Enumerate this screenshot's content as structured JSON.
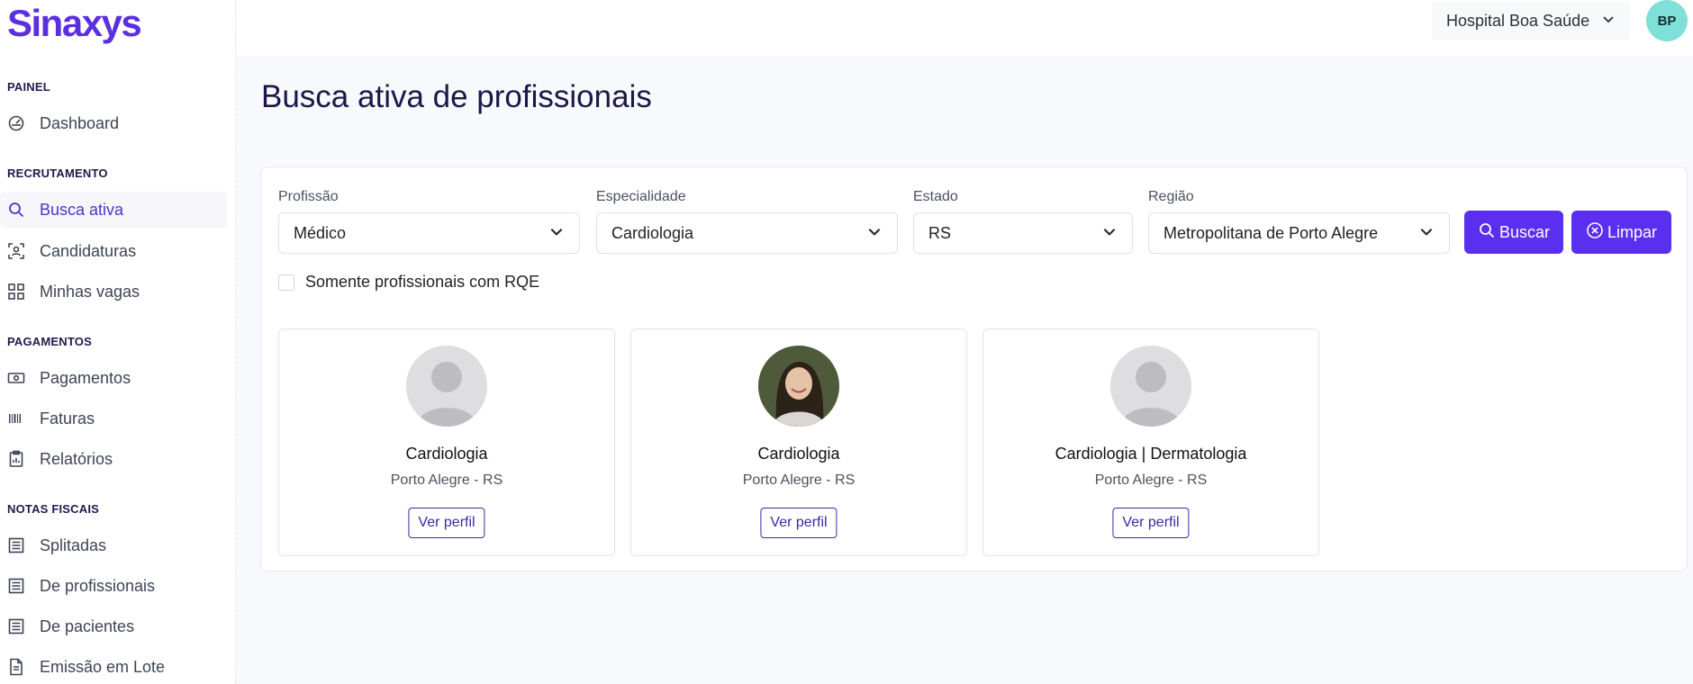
{
  "app": {
    "logo": "Sinaxys"
  },
  "sidebar": {
    "sections": [
      {
        "title": "PAINEL",
        "items": [
          {
            "label": "Dashboard",
            "icon": "dashboard-icon"
          }
        ]
      },
      {
        "title": "RECRUTAMENTO",
        "items": [
          {
            "label": "Busca ativa",
            "icon": "search-icon",
            "active": true
          },
          {
            "label": "Candidaturas",
            "icon": "user-scan-icon"
          },
          {
            "label": "Minhas vagas",
            "icon": "grid-icon"
          }
        ]
      },
      {
        "title": "PAGAMENTOS",
        "items": [
          {
            "label": "Pagamentos",
            "icon": "money-icon"
          },
          {
            "label": "Faturas",
            "icon": "barcode-icon"
          },
          {
            "label": "Relatórios",
            "icon": "clipboard-icon"
          }
        ]
      },
      {
        "title": "NOTAS FISCAIS",
        "items": [
          {
            "label": "Splitadas",
            "icon": "document-list-icon"
          },
          {
            "label": "De profissionais",
            "icon": "document-list-icon"
          },
          {
            "label": "De pacientes",
            "icon": "document-list-icon"
          },
          {
            "label": "Emissão em Lote",
            "icon": "file-icon"
          }
        ]
      }
    ]
  },
  "header": {
    "hospital": "Hospital Boa Saúde",
    "user_initials": "BP"
  },
  "page": {
    "title": "Busca ativa de profissionais"
  },
  "filters": {
    "profissao": {
      "label": "Profissão",
      "value": "Médico"
    },
    "especialidade": {
      "label": "Especialidade",
      "value": "Cardiologia"
    },
    "estado": {
      "label": "Estado",
      "value": "RS"
    },
    "regiao": {
      "label": "Região",
      "value": "Metropolitana de Porto Alegre"
    },
    "search_label": "Buscar",
    "clear_label": "Limpar",
    "rqe_label": "Somente profissionais com RQE",
    "rqe_checked": false
  },
  "results": [
    {
      "specialty": "Cardiologia",
      "location": "Porto Alegre - RS",
      "button": "Ver perfil",
      "photo": "placeholder"
    },
    {
      "specialty": "Cardiologia",
      "location": "Porto Alegre - RS",
      "button": "Ver perfil",
      "photo": "photo"
    },
    {
      "specialty": "Cardiologia | Dermatologia",
      "location": "Porto Alegre - RS",
      "button": "Ver perfil",
      "photo": "placeholder"
    }
  ],
  "colors": {
    "brand": "#5b2ee0",
    "button": "#5a2ff0",
    "avatar": "#7fe0d9"
  }
}
